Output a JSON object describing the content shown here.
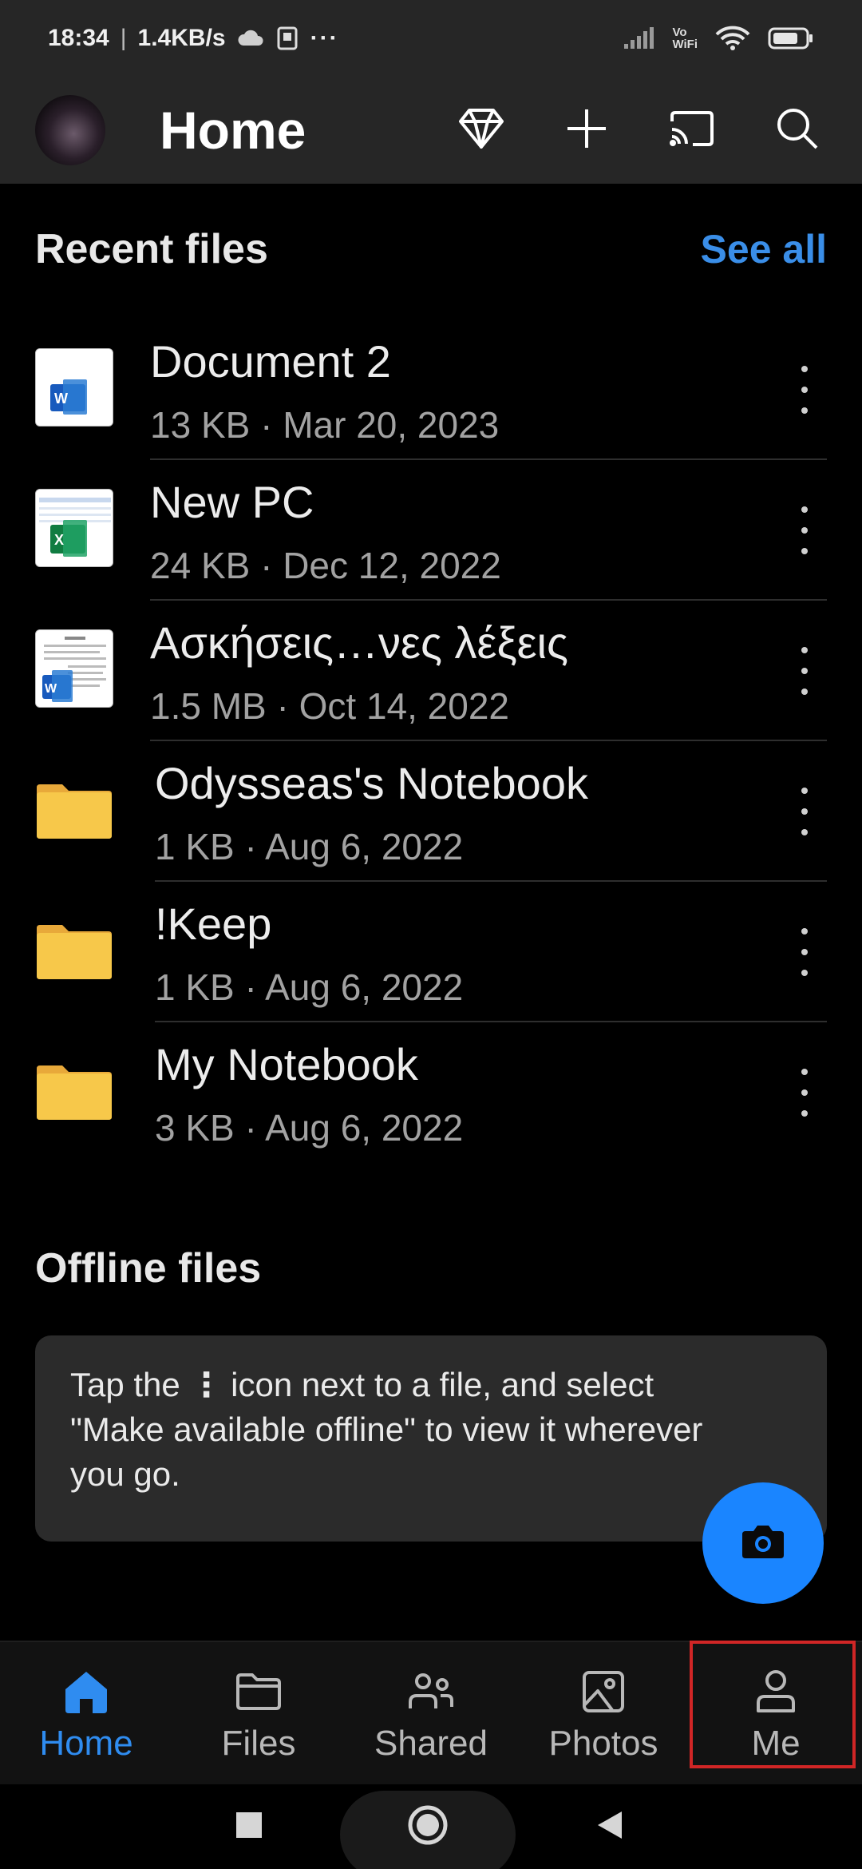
{
  "status_bar": {
    "time": "18:34",
    "speed": "1.4KB/s",
    "ellipsis": "···",
    "vowifi_top": "Vo",
    "vowifi_bottom": "WiFi"
  },
  "app_bar": {
    "title": "Home",
    "actions": [
      "diamond-icon",
      "plus-icon",
      "cast-icon",
      "search-icon"
    ]
  },
  "recent": {
    "title": "Recent files",
    "see_all": "See all",
    "files": [
      {
        "name": "Document 2",
        "meta": "13 KB · Mar 20, 2023",
        "kind": "word"
      },
      {
        "name": "New PC",
        "meta": "24 KB · Dec 12, 2022",
        "kind": "excel"
      },
      {
        "name": "Ασκήσεις…νες λέξεις",
        "meta": "1.5 MB · Oct 14, 2022",
        "kind": "word-doc"
      },
      {
        "name": "Odysseas's Notebook",
        "meta": "1 KB · Aug 6, 2022",
        "kind": "folder"
      },
      {
        "name": "!Keep",
        "meta": "1 KB · Aug 6, 2022",
        "kind": "folder"
      },
      {
        "name": "My Notebook",
        "meta": "3 KB · Aug 6, 2022",
        "kind": "folder"
      }
    ]
  },
  "offline": {
    "title": "Offline files",
    "hint_line1_a": "Tap the",
    "hint_line1_b": "icon next to a file, and select",
    "hint_line2": "\"Make available offline\" to view it wherever",
    "hint_line3": "you go."
  },
  "bottom_nav": {
    "items": [
      {
        "label": "Home",
        "icon": "home-icon",
        "active": true
      },
      {
        "label": "Files",
        "icon": "folder-icon",
        "active": false
      },
      {
        "label": "Shared",
        "icon": "people-icon",
        "active": false
      },
      {
        "label": "Photos",
        "icon": "photo-icon",
        "active": false
      },
      {
        "label": "Me",
        "icon": "person-icon",
        "active": false
      }
    ]
  },
  "colors": {
    "accent": "#1a85ff",
    "highlight": "#d02626",
    "folder": "#f7c84a"
  }
}
